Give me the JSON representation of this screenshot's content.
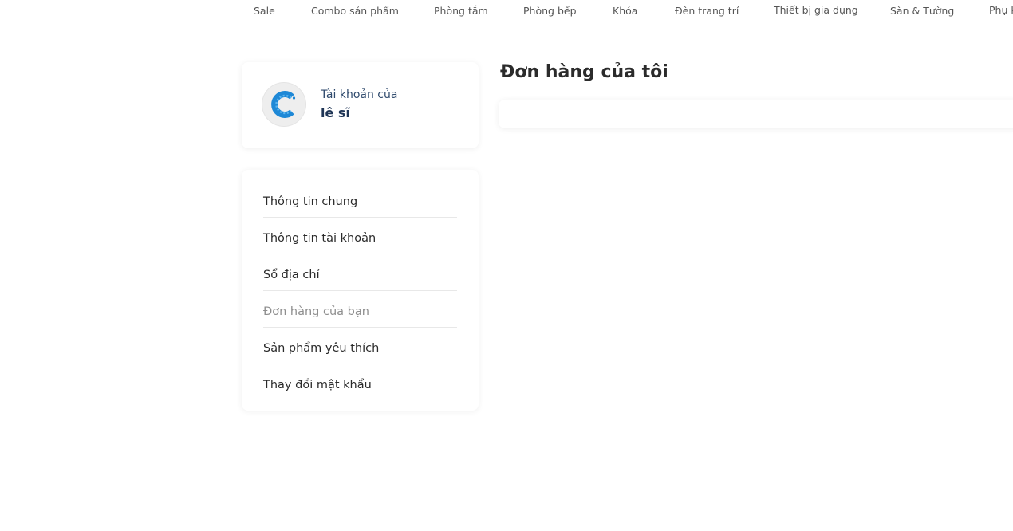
{
  "nav": {
    "items": [
      {
        "label": "Sale"
      },
      {
        "label": "Combo sản phẩm"
      },
      {
        "label": "Phòng tắm"
      },
      {
        "label": "Phòng bếp"
      },
      {
        "label": "Khóa"
      },
      {
        "label": "Đèn trang trí"
      },
      {
        "label": "Thiết bị gia dụng"
      },
      {
        "label": "Sàn & Tường"
      },
      {
        "label": "Phụ k"
      }
    ]
  },
  "account": {
    "caption": "Tài khoản của",
    "name": "lê sĩ",
    "avatar_icon": "c-logo-icon",
    "avatar_color": "#1e88d6"
  },
  "menu": {
    "items": [
      {
        "label": "Thông tin chung"
      },
      {
        "label": "Thông tin tài khoản"
      },
      {
        "label": "Sổ địa chỉ"
      },
      {
        "label": "Đơn hàng của bạn",
        "active": true
      },
      {
        "label": "Sản phẩm yêu thích"
      },
      {
        "label": "Thay đổi mật khẩu"
      }
    ]
  },
  "main": {
    "title": "Đơn hàng của tôi"
  }
}
